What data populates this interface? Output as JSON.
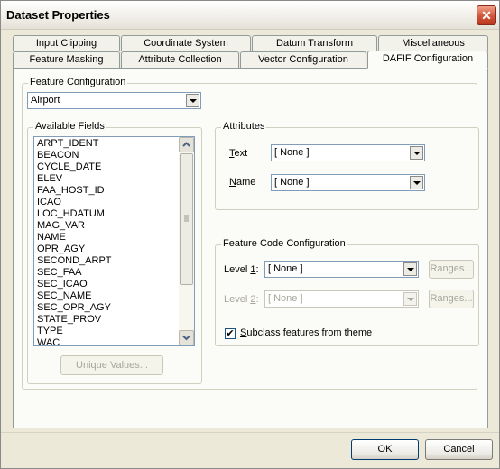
{
  "window": {
    "title": "Dataset Properties",
    "close_glyph": "✕"
  },
  "tabs_row1": [
    "Input Clipping",
    "Coordinate System",
    "Datum Transform",
    "Miscellaneous"
  ],
  "tabs_row2": [
    "Feature Masking",
    "Attribute Collection",
    "Vector Configuration",
    "DAFIF Configuration"
  ],
  "active_tab": "DAFIF Configuration",
  "feature_configuration": {
    "label": "Feature Configuration",
    "value": "Airport"
  },
  "available_fields": {
    "label": "Available Fields",
    "items": [
      "ARPT_IDENT",
      "BEACON",
      "CYCLE_DATE",
      "ELEV",
      "FAA_HOST_ID",
      "ICAO",
      "LOC_HDATUM",
      "MAG_VAR",
      "NAME",
      "OPR_AGY",
      "SECOND_ARPT",
      "SEC_FAA",
      "SEC_ICAO",
      "SEC_NAME",
      "SEC_OPR_AGY",
      "STATE_PROV",
      "TYPE",
      "WAC"
    ],
    "unique_values_button": "Unique Values..."
  },
  "attributes": {
    "label": "Attributes",
    "text_label_key": "T",
    "text_label_rest": "ext",
    "text_value": "[ None ]",
    "name_label_key": "N",
    "name_label_rest": "ame",
    "name_value": "[ None ]"
  },
  "feature_code": {
    "label": "Feature Code Configuration",
    "level1_pre": "Level ",
    "level1_key": "1",
    "level1_post": ":",
    "level1_value": "[ None ]",
    "level2_pre": "Level ",
    "level2_key": "2",
    "level2_post": ":",
    "level2_value": "[ None ]",
    "ranges_label": "Ranges...",
    "subclass_key": "S",
    "subclass_rest": "ubclass features from theme",
    "subclass_checked": true,
    "check_glyph": "✔"
  },
  "footer": {
    "ok": "OK",
    "cancel": "Cancel"
  }
}
